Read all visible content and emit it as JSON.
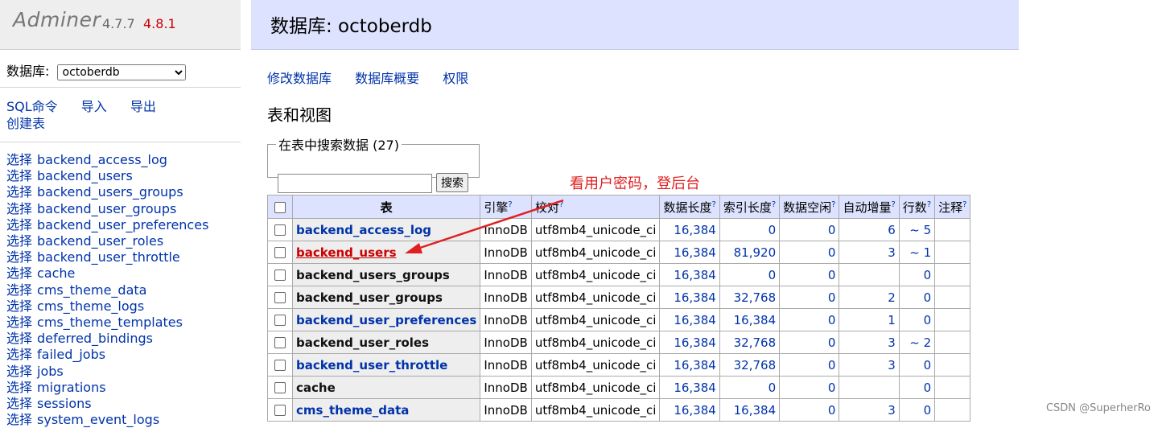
{
  "sidebar": {
    "logo": "Adminer",
    "version_current": "4.7.7",
    "version_new": "4.8.1",
    "db_label": "数据库:",
    "db_selected": "octoberdb",
    "commands": [
      "SQL命令",
      "导入",
      "导出"
    ],
    "create_table": "创建表",
    "select_prefix": "选择",
    "tables": [
      "backend_access_log",
      "backend_users",
      "backend_users_groups",
      "backend_user_groups",
      "backend_user_preferences",
      "backend_user_roles",
      "backend_user_throttle",
      "cache",
      "cms_theme_data",
      "cms_theme_logs",
      "cms_theme_templates",
      "deferred_bindings",
      "failed_jobs",
      "jobs",
      "migrations",
      "sessions",
      "system_event_logs"
    ]
  },
  "header": {
    "title": "数据库: octoberdb"
  },
  "main": {
    "links": [
      "修改数据库",
      "数据库概要",
      "权限"
    ],
    "section_title": "表和视图",
    "search_legend": "在表中搜索数据 (27)",
    "search_button": "搜索",
    "annotation": "看用户密码，登后台"
  },
  "table": {
    "headers": [
      "表",
      "引擎",
      "校对",
      "数据长度",
      "索引长度",
      "数据空闲",
      "自动增量",
      "行数",
      "注释"
    ],
    "help_mark": "?",
    "rows": [
      {
        "name": "backend_access_log",
        "engine": "InnoDB",
        "collation": "utf8mb4_unicode_ci",
        "data_length": "16,384",
        "index_length": "0",
        "data_free": "0",
        "auto_increment": "6",
        "rows": "~ 5",
        "comment": ""
      },
      {
        "name": "backend_users",
        "engine": "InnoDB",
        "collation": "utf8mb4_unicode_ci",
        "data_length": "16,384",
        "index_length": "81,920",
        "data_free": "0",
        "auto_increment": "3",
        "rows": "~ 1",
        "comment": ""
      },
      {
        "name": "backend_users_groups",
        "engine": "InnoDB",
        "collation": "utf8mb4_unicode_ci",
        "data_length": "16,384",
        "index_length": "0",
        "data_free": "0",
        "auto_increment": "",
        "rows": "0",
        "comment": ""
      },
      {
        "name": "backend_user_groups",
        "engine": "InnoDB",
        "collation": "utf8mb4_unicode_ci",
        "data_length": "16,384",
        "index_length": "32,768",
        "data_free": "0",
        "auto_increment": "2",
        "rows": "0",
        "comment": ""
      },
      {
        "name": "backend_user_preferences",
        "engine": "InnoDB",
        "collation": "utf8mb4_unicode_ci",
        "data_length": "16,384",
        "index_length": "16,384",
        "data_free": "0",
        "auto_increment": "1",
        "rows": "0",
        "comment": ""
      },
      {
        "name": "backend_user_roles",
        "engine": "InnoDB",
        "collation": "utf8mb4_unicode_ci",
        "data_length": "16,384",
        "index_length": "32,768",
        "data_free": "0",
        "auto_increment": "3",
        "rows": "~ 2",
        "comment": ""
      },
      {
        "name": "backend_user_throttle",
        "engine": "InnoDB",
        "collation": "utf8mb4_unicode_ci",
        "data_length": "16,384",
        "index_length": "32,768",
        "data_free": "0",
        "auto_increment": "3",
        "rows": "0",
        "comment": ""
      },
      {
        "name": "cache",
        "engine": "InnoDB",
        "collation": "utf8mb4_unicode_ci",
        "data_length": "16,384",
        "index_length": "0",
        "data_free": "0",
        "auto_increment": "",
        "rows": "0",
        "comment": ""
      },
      {
        "name": "cms_theme_data",
        "engine": "InnoDB",
        "collation": "utf8mb4_unicode_ci",
        "data_length": "16,384",
        "index_length": "16,384",
        "data_free": "0",
        "auto_increment": "3",
        "rows": "0",
        "comment": ""
      }
    ]
  },
  "watermark": "CSDN @SuperherRo",
  "colors": {
    "header_bg": "#dde3ff",
    "link": "#0033aa",
    "annotation": "#e02020",
    "new_version": "#cc0000"
  }
}
